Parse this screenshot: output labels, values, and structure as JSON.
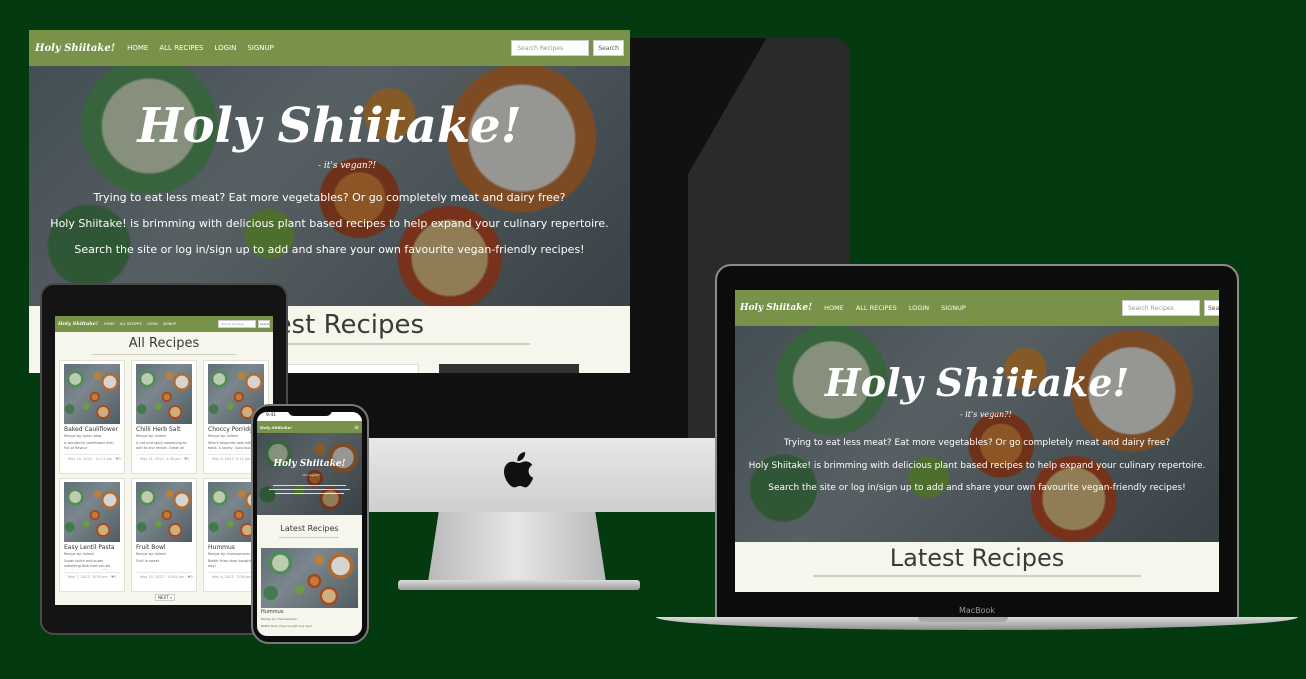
{
  "site": {
    "brand": "Holy Shiitake!",
    "nav": [
      "HOME",
      "ALL RECIPES",
      "LOGIN",
      "SIGNUP"
    ],
    "search_placeholder": "Search Recipes",
    "search_button": "Search",
    "hero_title": "Holy Shiitake!",
    "hero_subtitle": "- it's vegan?!",
    "hero_lines": [
      "Trying to eat less meat? Eat more vegetables? Or go completely meat and dairy free?",
      "Holy Shiitake! is brimming with delicious plant based recipes to help expand your culinary repertoire.",
      "Search the site or log in/sign up to add and share your own favourite vegan-friendly recipes!"
    ],
    "latest_title": "Latest Recipes"
  },
  "ipad": {
    "page_title": "All Recipes",
    "cards": [
      {
        "title": "Baked Cauliflower",
        "author": "Recipe by: kytsu blog",
        "desc": "A wonderful cauliflower dish, full of flavour",
        "footer": "May 10, 2022 · 11:11 pm · ♥0"
      },
      {
        "title": "Chilli Herb Salt",
        "author": "Recipe by: Admin",
        "desc": "A hot and spicy seasoning to add to any recipe. Great on potatoes, chips, corn on the cob... you name it!",
        "footer": "May 11, 2022, 2:06 pm · ♥0"
      },
      {
        "title": "Choccy Porridge",
        "author": "Recipe by: Admin",
        "desc": "Who's favourite oats with a twist. A lovely, luxurious way to start your breakfast.",
        "footer": "May 6, 2022, 3:11 pm · ♥0"
      },
      {
        "title": "Easy Lentil Pasta",
        "author": "Recipe by: Admin",
        "desc": "Super quick and super satisfying dish that can be knocked up in around 15 minutes with only 5 ingredients.",
        "footer": "May 7, 2022 · 8:59 pm · ♥0"
      },
      {
        "title": "Fruit Bowl",
        "author": "Recipe by: Admin",
        "desc": "Fruit is sweet",
        "footer": "May 10, 2022 · 10:04 pm · ♥0"
      },
      {
        "title": "Hummus",
        "author": "Recipe by: thomasmarin",
        "desc": "Better than shop bought any day!",
        "footer": "May 6, 2022 · 3:06 pm · ♥0"
      }
    ],
    "pager": "NEXT »"
  },
  "iphone": {
    "time": "9:41",
    "card_title": "Hummus",
    "card_author": "Recipe by: thomasmarin",
    "card_desc": "Better than shop bought any day!"
  },
  "macbook": {
    "label": "MacBook"
  },
  "colors": {
    "background": "#043a10",
    "navbar": "#78924a",
    "page": "#f6f6ec"
  }
}
